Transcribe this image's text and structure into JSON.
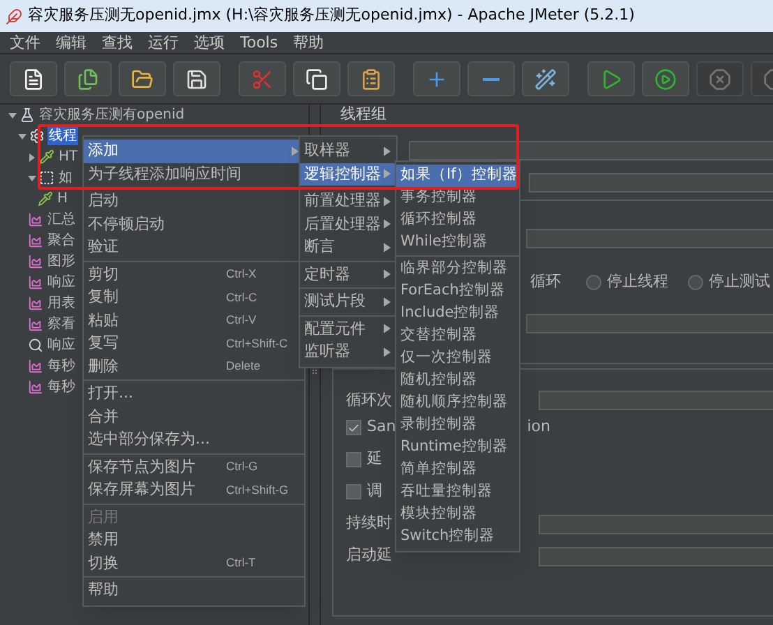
{
  "window": {
    "title": "容灾服务压测无openid.jmx (H:\\容灾服务压测无openid.jmx) - Apache JMeter (5.2.1)"
  },
  "menu_bar": [
    "文件",
    "编辑",
    "查找",
    "运行",
    "选项",
    "Tools",
    "帮助"
  ],
  "toolbar_buttons": [
    {
      "disabled": false
    },
    {
      "disabled": false
    },
    {
      "disabled": false
    },
    {
      "disabled": false
    },
    {
      "disabled": false
    },
    {
      "disabled": false
    },
    {
      "disabled": false
    },
    {
      "disabled": false
    },
    {
      "disabled": false
    },
    {
      "disabled": false
    },
    {
      "disabled": false
    },
    {
      "disabled": false
    },
    {
      "disabled": true
    },
    {
      "disabled": true
    }
  ],
  "tree": [
    {
      "label": "容灾服务压测有openid",
      "kind": "plan",
      "expanded": true,
      "selected": false,
      "children": [
        {
          "label": "线程",
          "kind": "thread_group",
          "expanded": true,
          "selected": true,
          "children": [
            {
              "label": "HT",
              "kind": "sampler",
              "expanded": false,
              "selected": false
            },
            {
              "label": "如",
              "kind": "controller",
              "expanded": true,
              "selected": false,
              "children": [
                {
                  "label": "H",
                  "kind": "sampler",
                  "selected": false
                }
              ]
            },
            {
              "label": "汇总",
              "kind": "listener",
              "selected": false
            },
            {
              "label": "聚合",
              "kind": "listener",
              "selected": false
            },
            {
              "label": "图形",
              "kind": "listener",
              "selected": false
            },
            {
              "label": "响应",
              "kind": "listener",
              "selected": false
            },
            {
              "label": "用表",
              "kind": "listener",
              "selected": false
            },
            {
              "label": "察看",
              "kind": "listener",
              "selected": false
            },
            {
              "label": "响应",
              "kind": "viewer",
              "selected": false
            },
            {
              "label": "每秒",
              "kind": "listener",
              "selected": false
            },
            {
              "label": "每秒",
              "kind": "listener",
              "selected": false
            }
          ]
        }
      ]
    }
  ],
  "panel": {
    "title": "线程组",
    "error_action": {
      "lead": "循环",
      "options": [
        {
          "label": "停止线程",
          "selected": false
        },
        {
          "label": "停止测试",
          "selected": false
        }
      ]
    },
    "loop_label": "循环次",
    "checkboxes": [
      {
        "label": "San",
        "tail": "ion",
        "checked": true
      },
      {
        "label": "延",
        "checked": false
      },
      {
        "label": "调",
        "checked": false
      }
    ],
    "duration_label": "持续时",
    "delay_label": "启动延"
  },
  "context_menu": [
    [
      {
        "label": "添加",
        "submenu": true,
        "selected": true,
        "disabled": false
      },
      {
        "label": "为子线程添加响应时间",
        "submenu": false,
        "selected": false,
        "disabled": false
      }
    ],
    [
      {
        "label": "启动",
        "submenu": false,
        "selected": false,
        "disabled": false
      },
      {
        "label": "不停顿启动",
        "submenu": false,
        "selected": false,
        "disabled": false
      },
      {
        "label": "验证",
        "submenu": false,
        "selected": false,
        "disabled": false
      }
    ],
    [
      {
        "label": "剪切",
        "shortcut": "Ctrl-X",
        "submenu": false,
        "selected": false,
        "disabled": false
      },
      {
        "label": "复制",
        "shortcut": "Ctrl-C",
        "submenu": false,
        "selected": false,
        "disabled": false
      },
      {
        "label": "粘贴",
        "shortcut": "Ctrl-V",
        "submenu": false,
        "selected": false,
        "disabled": false
      },
      {
        "label": "复写",
        "shortcut": "Ctrl+Shift-C",
        "submenu": false,
        "selected": false,
        "disabled": false
      },
      {
        "label": "删除",
        "shortcut": "Delete",
        "submenu": false,
        "selected": false,
        "disabled": false
      }
    ],
    [
      {
        "label": "打开...",
        "submenu": false,
        "selected": false,
        "disabled": false
      },
      {
        "label": "合并",
        "submenu": false,
        "selected": false,
        "disabled": false
      },
      {
        "label": "选中部分保存为...",
        "submenu": false,
        "selected": false,
        "disabled": false
      }
    ],
    [
      {
        "label": "保存节点为图片",
        "shortcut": "Ctrl-G",
        "submenu": false,
        "selected": false,
        "disabled": false
      },
      {
        "label": "保存屏幕为图片",
        "shortcut": "Ctrl+Shift-G",
        "submenu": false,
        "selected": false,
        "disabled": false
      }
    ],
    [
      {
        "label": "启用",
        "submenu": false,
        "selected": false,
        "disabled": true
      },
      {
        "label": "禁用",
        "submenu": false,
        "selected": false,
        "disabled": false
      },
      {
        "label": "切换",
        "shortcut": "Ctrl-T",
        "submenu": false,
        "selected": false,
        "disabled": false
      }
    ],
    [
      {
        "label": "帮助",
        "submenu": false,
        "selected": false,
        "disabled": false
      }
    ]
  ],
  "add_submenu": [
    [
      {
        "label": "取样器",
        "selected": false
      },
      {
        "label": "逻辑控制器",
        "selected": true
      }
    ],
    [
      {
        "label": "前置处理器",
        "selected": false
      },
      {
        "label": "后置处理器",
        "selected": false
      },
      {
        "label": "断言",
        "selected": false
      }
    ],
    [
      {
        "label": "定时器",
        "selected": false
      }
    ],
    [
      {
        "label": "测试片段",
        "selected": false
      }
    ],
    [
      {
        "label": "配置元件",
        "selected": false
      },
      {
        "label": "监听器",
        "selected": false
      }
    ]
  ],
  "logic_controller_submenu": [
    [
      {
        "label": "如果（If）控制器",
        "selected": true
      },
      {
        "label": "事务控制器",
        "selected": false
      },
      {
        "label": "循环控制器",
        "selected": false
      },
      {
        "label": "While控制器",
        "selected": false
      }
    ],
    [
      {
        "label": "临界部分控制器",
        "selected": false
      },
      {
        "label": "ForEach控制器",
        "selected": false
      },
      {
        "label": "Include控制器",
        "selected": false
      },
      {
        "label": "交替控制器",
        "selected": false
      },
      {
        "label": "仅一次控制器",
        "selected": false
      },
      {
        "label": "随机控制器",
        "selected": false
      },
      {
        "label": "随机顺序控制器",
        "selected": false
      },
      {
        "label": "录制控制器",
        "selected": false
      },
      {
        "label": "Runtime控制器",
        "selected": false
      },
      {
        "label": "简单控制器",
        "selected": false
      },
      {
        "label": "吞吐量控制器",
        "selected": false
      },
      {
        "label": "模块控制器",
        "selected": false
      },
      {
        "label": "Switch控制器",
        "selected": false
      }
    ]
  ]
}
